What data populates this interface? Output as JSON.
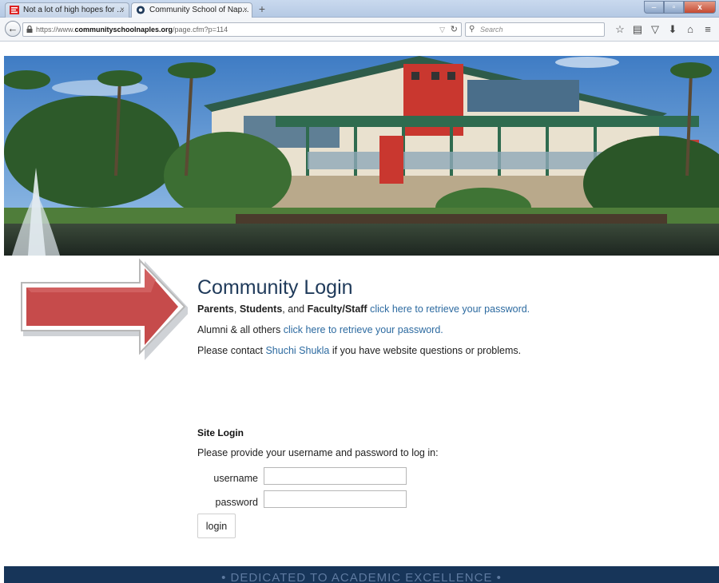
{
  "browser": {
    "tabs": [
      {
        "title": "Not a lot of high hopes for ...",
        "close": "×"
      },
      {
        "title": "Community School of Nap...",
        "close": "×"
      }
    ],
    "new_tab": "+",
    "window_controls": {
      "minimize": "–",
      "maximize": "▫",
      "close": "x"
    },
    "url_prefix": "https://www.",
    "url_host": "communityschoolnaples.org",
    "url_path": "/page.cfm?p=114",
    "search_placeholder": "Search",
    "icons": [
      "star-icon",
      "reading-list-icon",
      "pocket-icon",
      "download-icon",
      "home-icon",
      "menu-icon"
    ]
  },
  "page": {
    "title": "Community Login",
    "line1": {
      "parents": "Parents",
      "sep1": ", ",
      "students": "Students",
      "sep2": ", and ",
      "faculty": "Faculty/Staff",
      "link": "click here to retrieve your password."
    },
    "line2": {
      "prefix": "Alumni & all others ",
      "link": "click here to retrieve your password."
    },
    "line3": {
      "prefix": "Please contact ",
      "link": "Shuchi Shukla",
      "suffix": " if you have website questions or problems."
    },
    "site_login": {
      "heading": "Site Login",
      "instructions": "Please provide your username and password to log in:",
      "username_label": "username",
      "username_value": "",
      "password_label": "password",
      "password_value": "",
      "button": "login"
    },
    "footer": "•    DEDICATED TO ACADEMIC EXCELLENCE    •"
  },
  "colors": {
    "title": "#1f3a5a",
    "link": "#2c6aa0",
    "footer_bg": "#173559",
    "arrow": "#c64b4b"
  }
}
